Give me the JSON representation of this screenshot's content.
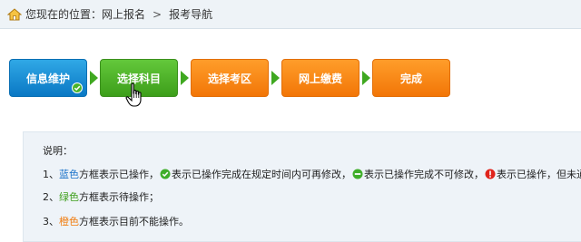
{
  "breadcrumb": {
    "prefix": "您现在的位置：",
    "item1": "网上报名",
    "separator": ">",
    "item2": "报考导航"
  },
  "steps": [
    {
      "label": "信息维护",
      "color": "#1a85d3",
      "status": "done"
    },
    {
      "label": "选择科目",
      "color": "#4fb52a",
      "status": "current"
    },
    {
      "label": "选择考区",
      "color": "#f5860f",
      "status": "locked"
    },
    {
      "label": "网上缴费",
      "color": "#f5860f",
      "status": "locked"
    },
    {
      "label": "完成",
      "color": "#f5860f",
      "status": "locked"
    }
  ],
  "notes": {
    "title": "说明：",
    "line1": {
      "num": "1、",
      "color_word": "蓝色",
      "text_a": "方框表示已操作，",
      "text_b": "表示已操作完成在规定时间内可再修改，",
      "text_c": "表示已操作完成不可修改，",
      "text_d": "表示已操作，但未通过；"
    },
    "line2": {
      "num": "2、",
      "color_word": "绿色",
      "text": "方框表示待操作；"
    },
    "line3": {
      "num": "3、",
      "color_word": "橙色",
      "text": "方框表示目前不能操作。"
    }
  }
}
